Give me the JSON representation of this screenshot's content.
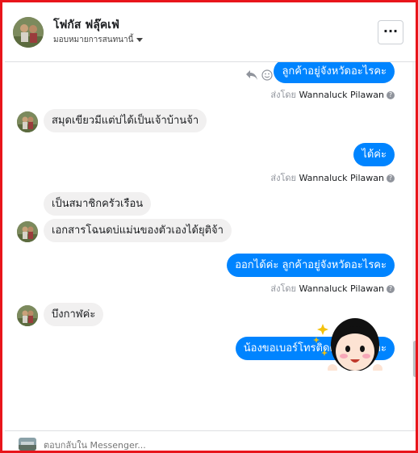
{
  "header": {
    "name": "โฟกัส ฟลุ๊คเฟ่",
    "subtitle": "มอบหมายการสนทนานี้",
    "menu_label": "···"
  },
  "messages": [
    {
      "side": "out",
      "text": "ลูกค้าอยู่จังหวัดอะไรคะ"
    },
    {
      "side": "in",
      "text": "สมุดเขียวมีแต่บ่ได้เป็นเจ้าบ้านจ้า"
    },
    {
      "side": "out",
      "text": "ได้ค่ะ"
    },
    {
      "side": "in",
      "text": "เป็นสมาชิกครัวเรือน"
    },
    {
      "side": "in",
      "text": "เอกสารโฉนดบ่แม่นของตัวเองได้ยุติจ้า"
    },
    {
      "side": "out",
      "text": "ออกได้ค่ะ ลูกค้าอยู่จังหวัดอะไรคะ"
    },
    {
      "side": "in",
      "text": "บึงกาฬค่ะ"
    },
    {
      "side": "out",
      "text": "น้องขอเบอร์โทรติดต่อได้ไหมคะ"
    }
  ],
  "sent_by": {
    "prefix": "ส่งโดย",
    "sender": "Wannaluck Pilawan",
    "help": "?"
  },
  "composer": {
    "placeholder": "ตอบกลับใน Messenger..."
  },
  "colors": {
    "frame": "#e8151b",
    "outgoing": "#0084ff",
    "incoming": "#f1f0f0"
  },
  "icons": [
    "reply-icon",
    "emoji-icon",
    "more-icon",
    "help-icon",
    "chevron-down-icon"
  ]
}
